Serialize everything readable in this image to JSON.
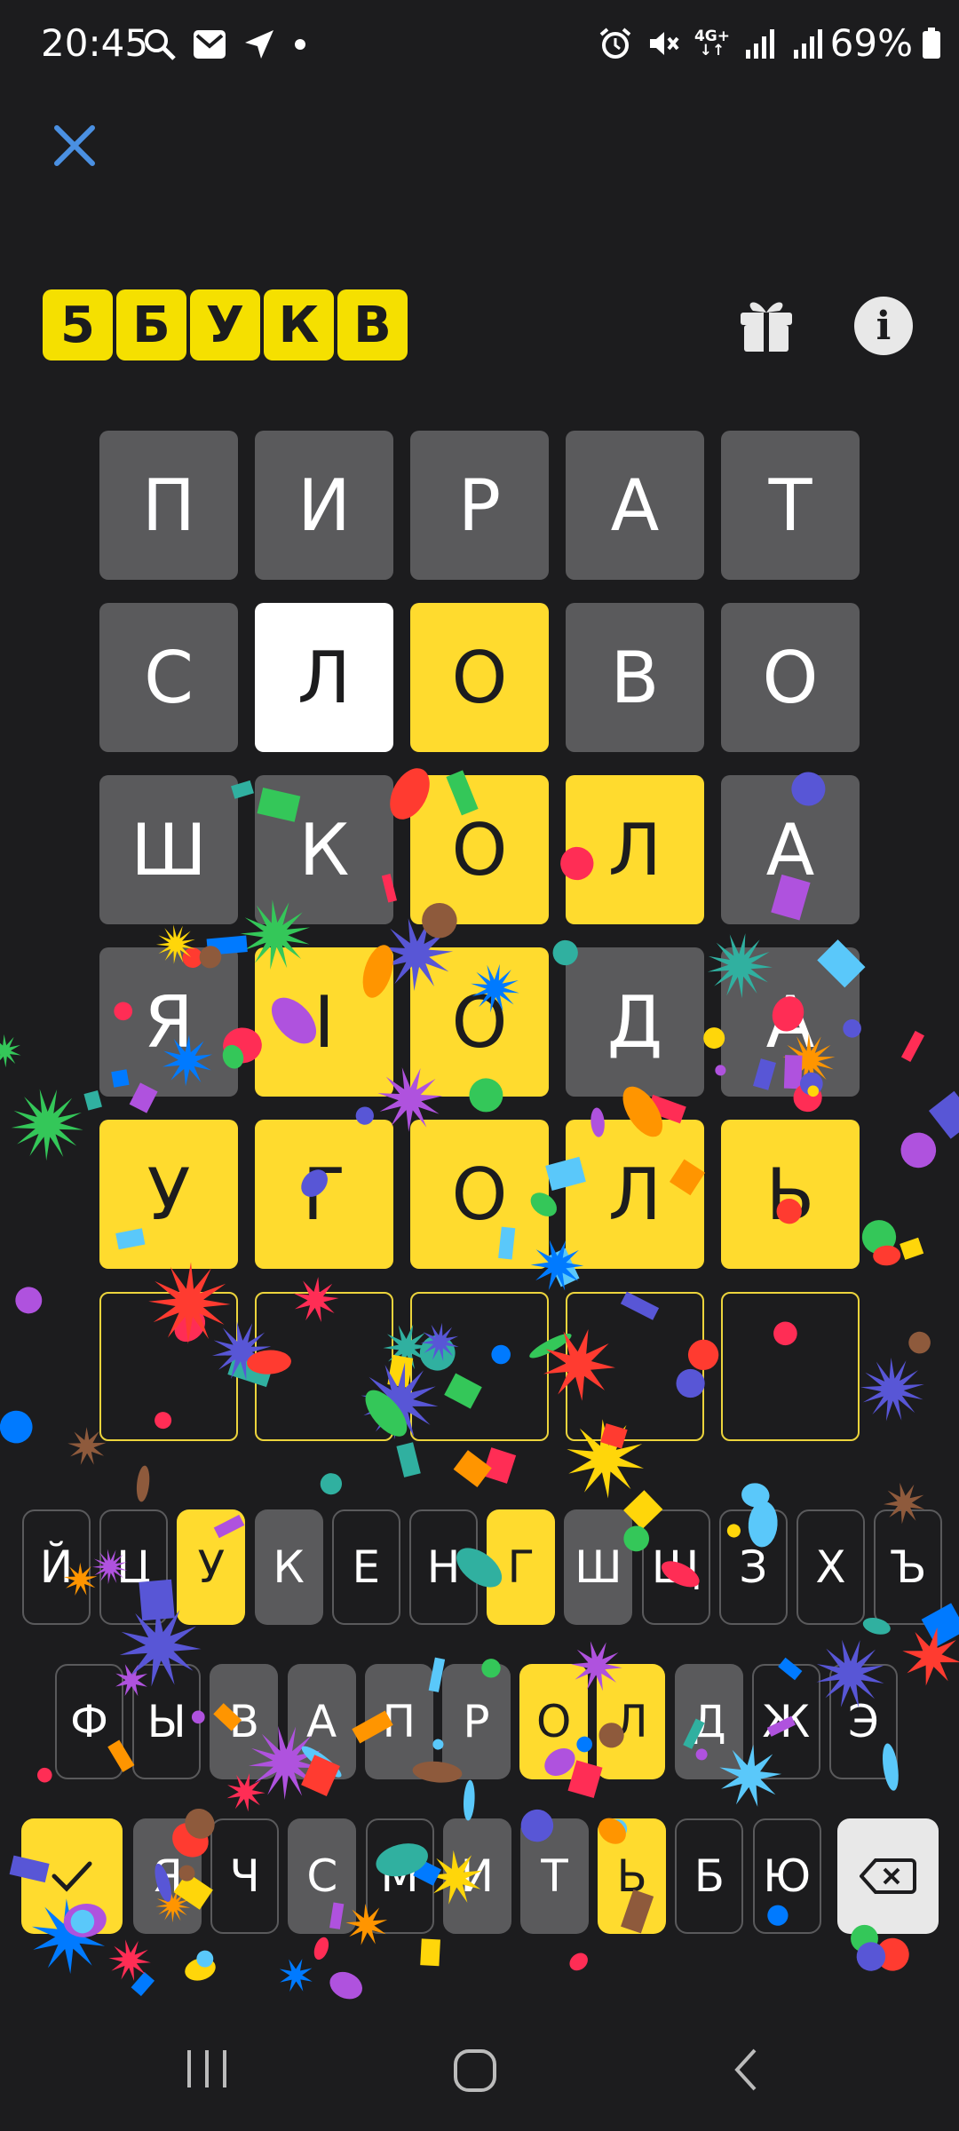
{
  "status_bar": {
    "time": "20:45",
    "battery": "69%",
    "network": "4G+",
    "left_icons": [
      "search-icon",
      "mail-icon",
      "location-arrow-icon",
      "dot-icon"
    ],
    "right_icons": [
      "alarm-icon",
      "mute-icon",
      "network-4g-icon",
      "signal-icon",
      "signal-icon"
    ]
  },
  "header": {
    "close_icon": "close-icon",
    "logo_letters": [
      "5",
      "Б",
      "У",
      "К",
      "В"
    ],
    "gift_icon": "gift-icon",
    "info_label": "i"
  },
  "board": {
    "rows": [
      {
        "letters": [
          "П",
          "И",
          "Р",
          "А",
          "Т"
        ],
        "states": [
          "absent",
          "absent",
          "absent",
          "absent",
          "absent"
        ]
      },
      {
        "letters": [
          "С",
          "Л",
          "О",
          "В",
          "О"
        ],
        "states": [
          "absent",
          "present",
          "correct",
          "absent",
          "absent"
        ]
      },
      {
        "letters": [
          "Ш",
          "К",
          "О",
          "Л",
          "А"
        ],
        "states": [
          "absent",
          "absent",
          "correct",
          "correct",
          "absent"
        ]
      },
      {
        "letters": [
          "Я",
          "І",
          "О",
          "Д",
          "А"
        ],
        "states": [
          "absent",
          "correct",
          "correct",
          "absent",
          "absent"
        ]
      },
      {
        "letters": [
          "У",
          "Г",
          "О",
          "Л",
          "Ь"
        ],
        "states": [
          "correct",
          "correct",
          "correct",
          "correct",
          "correct"
        ]
      },
      {
        "letters": [
          "",
          "",
          "",
          "",
          ""
        ],
        "states": [
          "empty",
          "empty",
          "empty",
          "empty",
          "empty"
        ]
      }
    ]
  },
  "keyboard": {
    "row1": {
      "keys": [
        "Й",
        "Ц",
        "У",
        "К",
        "Е",
        "Н",
        "Г",
        "Ш",
        "Щ",
        "З",
        "Х",
        "Ъ"
      ],
      "states": [
        "unused",
        "unused",
        "correct",
        "absent",
        "unused",
        "unused",
        "correct",
        "absent",
        "unused",
        "unused",
        "unused",
        "unused"
      ]
    },
    "row2": {
      "keys": [
        "Ф",
        "Ы",
        "В",
        "А",
        "П",
        "Р",
        "О",
        "Л",
        "Д",
        "Ж",
        "Э"
      ],
      "states": [
        "unused",
        "unused",
        "absent",
        "absent",
        "absent",
        "absent",
        "correct",
        "correct",
        "absent",
        "unused",
        "unused"
      ]
    },
    "row3": {
      "keys": [
        "Я",
        "Ч",
        "С",
        "М",
        "И",
        "Т",
        "Ь",
        "Б",
        "Ю"
      ],
      "states": [
        "absent",
        "unused",
        "absent",
        "unused",
        "absent",
        "absent",
        "correct",
        "unused",
        "unused"
      ]
    },
    "enter_icon": "checkmark-icon",
    "backspace_icon": "backspace-icon"
  },
  "nav": {
    "icons": [
      "recent-apps-icon",
      "home-icon",
      "back-icon"
    ]
  },
  "colors": {
    "background": "#1c1c1e",
    "absent": "#5a5a5c",
    "correct": "#ffdb2e",
    "present": "#ffffff",
    "logo": "#f5e000",
    "confetti": [
      "#ff3b30",
      "#ffd60a",
      "#34c759",
      "#007aff",
      "#af52de",
      "#ff9500",
      "#ff2d55",
      "#5ac8fa",
      "#30b0a0",
      "#8e5a3c",
      "#5856d6"
    ]
  }
}
